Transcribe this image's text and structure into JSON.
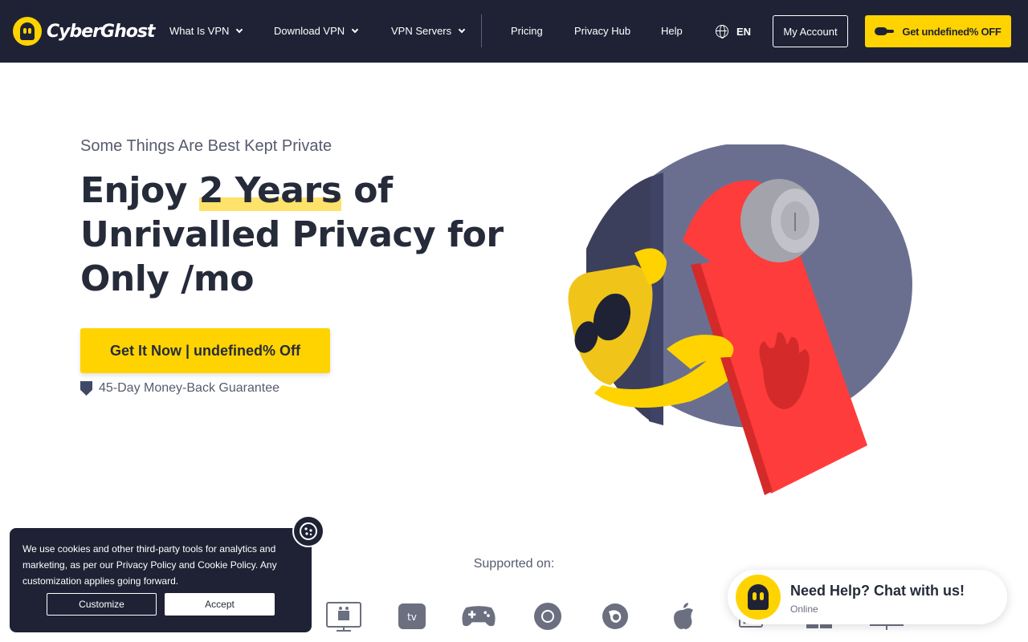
{
  "header": {
    "logo_text": "CyberGhost",
    "nav": [
      {
        "label": "What Is VPN",
        "has_dropdown": true
      },
      {
        "label": "Download VPN",
        "has_dropdown": true
      },
      {
        "label": "VPN Servers",
        "has_dropdown": true
      },
      {
        "label": "Pricing",
        "has_dropdown": false
      },
      {
        "label": "Privacy Hub",
        "has_dropdown": false
      },
      {
        "label": "Help",
        "has_dropdown": false
      }
    ],
    "language": "EN",
    "account_label": "My Account",
    "deal_label": "Get undefined% OFF"
  },
  "hero": {
    "kicker": "Some Things Are Best Kept Private",
    "title_pre": "Enjoy ",
    "title_highlight": "2 Years",
    "title_post": " of Unrivalled Privacy for Only /mo",
    "cta_label": "Get It Now | undefined% Off",
    "guarantee": "45-Day Money-Back Guarantee"
  },
  "supported": {
    "label": "Supported on:",
    "platforms": [
      "android-tv-icon",
      "apple-tv-icon",
      "game-console-icon",
      "chrome-icon",
      "firefox-icon",
      "apple-icon",
      "router-icon",
      "windows-icon",
      "desktop-icon"
    ]
  },
  "cookie": {
    "text": "We use cookies and other third-party tools for analytics and marketing, as per our Privacy Policy and Cookie Policy. Any customization applies going forward.",
    "customize_label": "Customize",
    "accept_label": "Accept"
  },
  "chat": {
    "title": "Need Help? Chat with us!",
    "status": "Online"
  },
  "colors": {
    "navy": "#1f2235",
    "yellow": "#ffd300",
    "red": "#ff3c3c",
    "purple": "#6b6f8f",
    "text": "#262b3a"
  }
}
